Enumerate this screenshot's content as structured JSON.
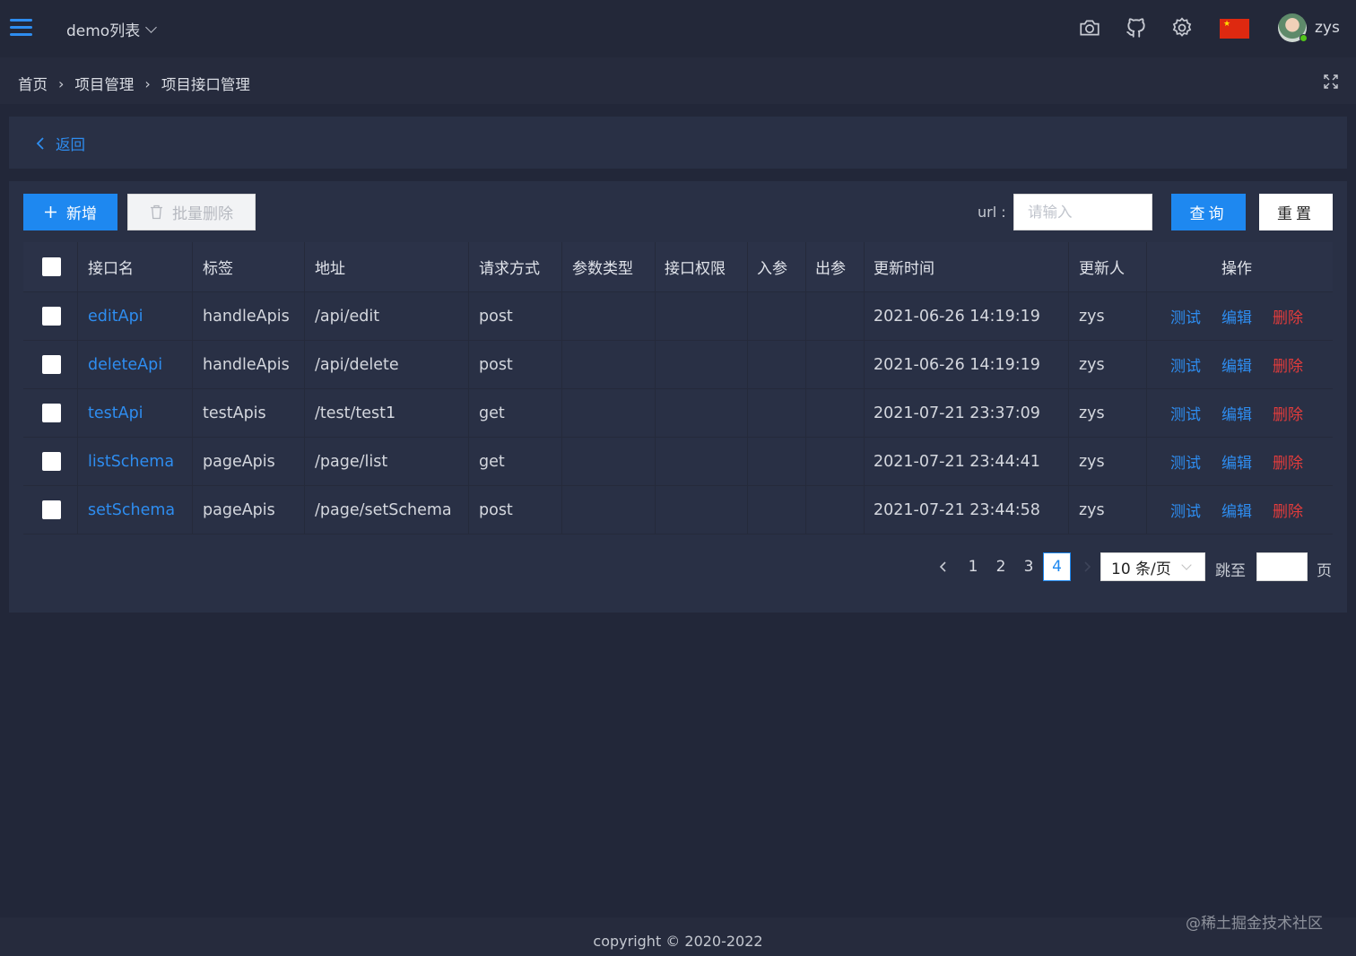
{
  "header": {
    "app_name": "demo列表",
    "username": "zys",
    "icons": [
      "camera-icon",
      "github-icon",
      "gear-icon",
      "china-flag-icon",
      "avatar"
    ]
  },
  "breadcrumb": {
    "items": [
      "首页",
      "项目管理",
      "项目接口管理"
    ],
    "separator": "›"
  },
  "back": {
    "label": "返回"
  },
  "toolbar": {
    "add_label": "新增",
    "batch_delete_label": "批量删除",
    "url_label": "url :",
    "url_placeholder": "请输入",
    "url_value": "",
    "query_label": "查询",
    "reset_label": "重置"
  },
  "table": {
    "columns": [
      "接口名",
      "标签",
      "地址",
      "请求方式",
      "参数类型",
      "接口权限",
      "入参",
      "出参",
      "更新时间",
      "更新人",
      "操作"
    ],
    "rows": [
      {
        "name": "editApi",
        "tag": "handleApis",
        "address": "/api/edit",
        "method": "post",
        "param_type": "",
        "permission": "",
        "input": "",
        "output": "",
        "updated_at": "2021-06-26 14:19:19",
        "updated_by": "zys"
      },
      {
        "name": "deleteApi",
        "tag": "handleApis",
        "address": "/api/delete",
        "method": "post",
        "param_type": "",
        "permission": "",
        "input": "",
        "output": "",
        "updated_at": "2021-06-26 14:19:19",
        "updated_by": "zys"
      },
      {
        "name": "testApi",
        "tag": "testApis",
        "address": "/test/test1",
        "method": "get",
        "param_type": "",
        "permission": "",
        "input": "",
        "output": "",
        "updated_at": "2021-07-21 23:37:09",
        "updated_by": "zys"
      },
      {
        "name": "listSchema",
        "tag": "pageApis",
        "address": "/page/list",
        "method": "get",
        "param_type": "",
        "permission": "",
        "input": "",
        "output": "",
        "updated_at": "2021-07-21 23:44:41",
        "updated_by": "zys"
      },
      {
        "name": "setSchema",
        "tag": "pageApis",
        "address": "/page/setSchema",
        "method": "post",
        "param_type": "",
        "permission": "",
        "input": "",
        "output": "",
        "updated_at": "2021-07-21 23:44:58",
        "updated_by": "zys"
      }
    ],
    "actions": {
      "test": "测试",
      "edit": "编辑",
      "delete": "删除"
    }
  },
  "pagination": {
    "pages": [
      "1",
      "2",
      "3",
      "4"
    ],
    "current": "4",
    "page_size": "10 条/页",
    "jump_label": "跳至",
    "page_label": "页"
  },
  "footer": {
    "copyright": "copyright © 2020-2022"
  },
  "watermark": "@稀土掘金技术社区",
  "colors": {
    "primary": "#1e88f0",
    "danger": "#e23c3c",
    "background": "#222739",
    "card": "#293045"
  }
}
